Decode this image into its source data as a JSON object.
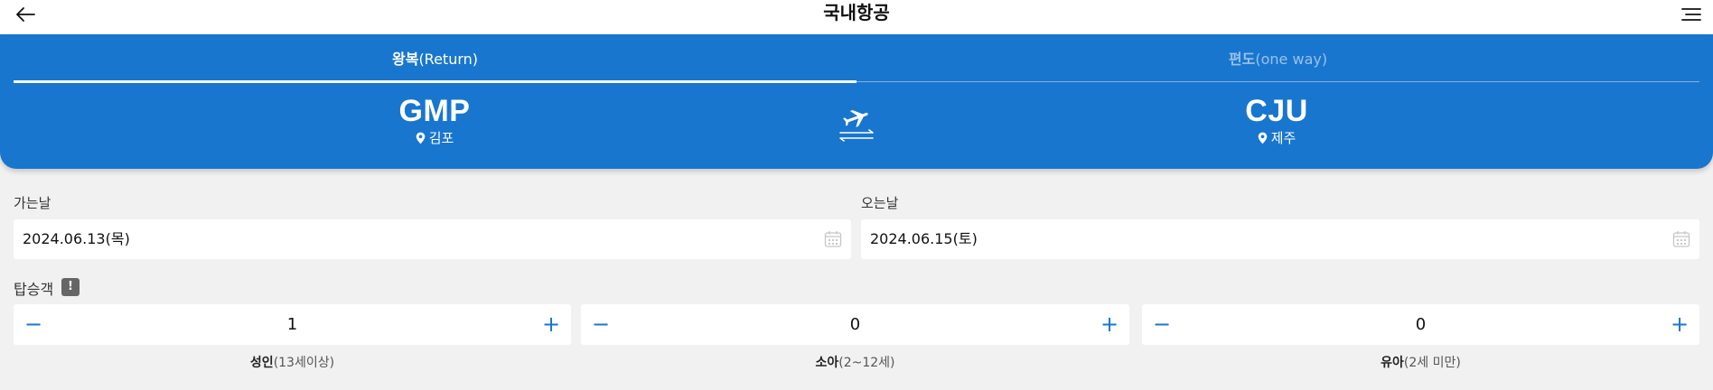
{
  "header": {
    "title": "국내항공",
    "back_icon": "arrow-left-icon",
    "menu_icon": "hamburger-menu-icon"
  },
  "trip_tabs": {
    "return_main": "왕복",
    "return_sub": "(Return)",
    "oneway_main": "편도",
    "oneway_sub": "(one way)",
    "active": "return"
  },
  "route": {
    "from_code": "GMP",
    "from_city": "김포",
    "to_code": "CJU",
    "to_city": "제주",
    "swap_icon": "airplane-swap-icon"
  },
  "dates": {
    "depart_label": "가는날",
    "depart_value": "2024.06.13(목)",
    "return_label": "오는날",
    "return_value": "2024.06.15(토)"
  },
  "passengers": {
    "label": "탑승객",
    "info_badge": "!",
    "items": [
      {
        "count": "1",
        "main": "성인",
        "sub": "(13세이상)"
      },
      {
        "count": "0",
        "main": "소아",
        "sub": "(2~12세)"
      },
      {
        "count": "0",
        "main": "유아",
        "sub": "(2세 미만)"
      }
    ],
    "minus": "−",
    "plus": "+"
  },
  "colors": {
    "brand_blue": "#1976cf",
    "background": "#f1f1f1"
  }
}
